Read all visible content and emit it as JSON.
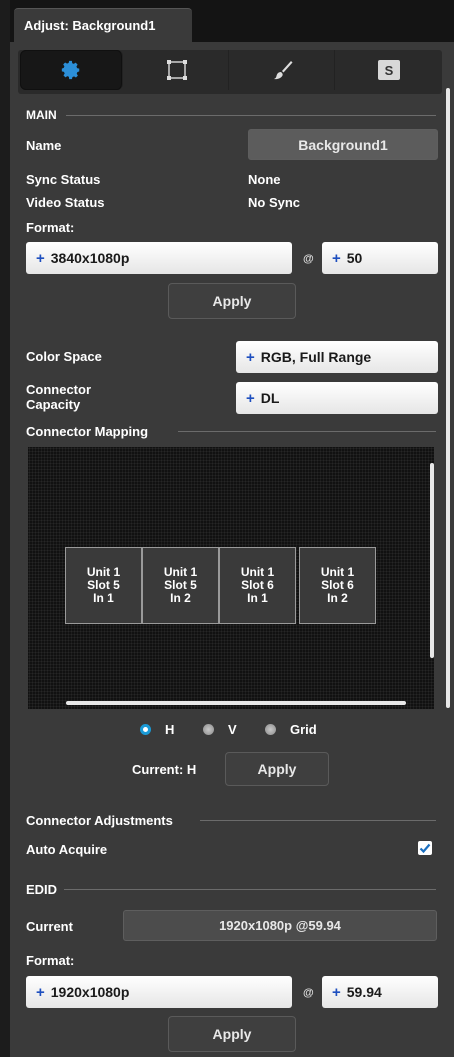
{
  "window": {
    "title": "Adjust: Background1"
  },
  "toolbar": {
    "tabs": [
      {
        "icon": "gear-icon",
        "active": true
      },
      {
        "icon": "crop-icon",
        "active": false
      },
      {
        "icon": "brush-icon",
        "active": false
      },
      {
        "icon": "s-icon",
        "label": "S",
        "active": false
      }
    ]
  },
  "main": {
    "section_label": "MAIN",
    "name_label": "Name",
    "name_value": "Background1",
    "sync_status_label": "Sync Status",
    "sync_status_value": "None",
    "video_status_label": "Video Status",
    "video_status_value": "No Sync",
    "format_label": "Format:",
    "format_value": "3840x1080p",
    "at_symbol": "@",
    "rate_value": "50",
    "apply_label": "Apply",
    "color_space_label": "Color Space",
    "color_space_value": "RGB, Full Range",
    "connector_capacity_label_1": "Connector",
    "connector_capacity_label_2": "Capacity",
    "connector_capacity_value": "DL"
  },
  "mapping": {
    "section_label": "Connector Mapping",
    "cells": [
      {
        "line1": "Unit 1",
        "line2": "Slot 5",
        "line3": "In 1"
      },
      {
        "line1": "Unit 1",
        "line2": "Slot 5",
        "line3": "In 2"
      },
      {
        "line1": "Unit 1",
        "line2": "Slot 6",
        "line3": "In 1"
      },
      {
        "line1": "Unit 1",
        "line2": "Slot 6",
        "line3": "In 2"
      }
    ],
    "orientation_options": [
      "H",
      "V",
      "Grid"
    ],
    "orientation_selected": "H",
    "current_label": "Current: H",
    "apply_label": "Apply"
  },
  "adjustments": {
    "section_label": "Connector Adjustments",
    "auto_acquire_label": "Auto Acquire",
    "auto_acquire_checked": true
  },
  "edid": {
    "section_label": "EDID",
    "current_label": "Current",
    "current_value": "1920x1080p @59.94",
    "format_label": "Format:",
    "format_value": "1920x1080p",
    "at_symbol": "@",
    "rate_value": "59.94",
    "apply_label": "Apply"
  },
  "colors": {
    "accent": "#1a9ad6",
    "panel": "#3a3a3a",
    "field": "#ffffff",
    "plus": "#1e4fbf"
  }
}
